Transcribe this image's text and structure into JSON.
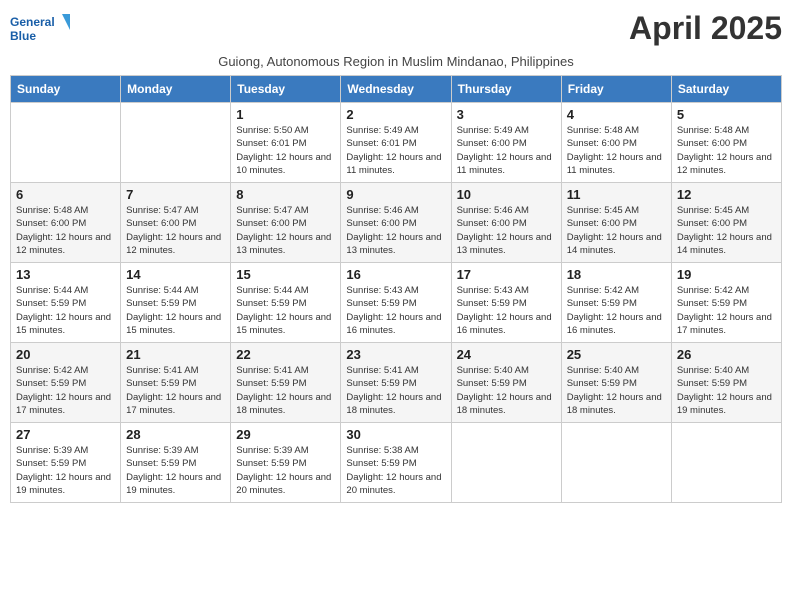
{
  "logo": {
    "general": "General",
    "blue": "Blue"
  },
  "title": "April 2025",
  "subtitle": "Guiong, Autonomous Region in Muslim Mindanao, Philippines",
  "weekdays": [
    "Sunday",
    "Monday",
    "Tuesday",
    "Wednesday",
    "Thursday",
    "Friday",
    "Saturday"
  ],
  "weeks": [
    [
      {
        "day": "",
        "info": ""
      },
      {
        "day": "",
        "info": ""
      },
      {
        "day": "1",
        "info": "Sunrise: 5:50 AM\nSunset: 6:01 PM\nDaylight: 12 hours and 10 minutes."
      },
      {
        "day": "2",
        "info": "Sunrise: 5:49 AM\nSunset: 6:01 PM\nDaylight: 12 hours and 11 minutes."
      },
      {
        "day": "3",
        "info": "Sunrise: 5:49 AM\nSunset: 6:00 PM\nDaylight: 12 hours and 11 minutes."
      },
      {
        "day": "4",
        "info": "Sunrise: 5:48 AM\nSunset: 6:00 PM\nDaylight: 12 hours and 11 minutes."
      },
      {
        "day": "5",
        "info": "Sunrise: 5:48 AM\nSunset: 6:00 PM\nDaylight: 12 hours and 12 minutes."
      }
    ],
    [
      {
        "day": "6",
        "info": "Sunrise: 5:48 AM\nSunset: 6:00 PM\nDaylight: 12 hours and 12 minutes."
      },
      {
        "day": "7",
        "info": "Sunrise: 5:47 AM\nSunset: 6:00 PM\nDaylight: 12 hours and 12 minutes."
      },
      {
        "day": "8",
        "info": "Sunrise: 5:47 AM\nSunset: 6:00 PM\nDaylight: 12 hours and 13 minutes."
      },
      {
        "day": "9",
        "info": "Sunrise: 5:46 AM\nSunset: 6:00 PM\nDaylight: 12 hours and 13 minutes."
      },
      {
        "day": "10",
        "info": "Sunrise: 5:46 AM\nSunset: 6:00 PM\nDaylight: 12 hours and 13 minutes."
      },
      {
        "day": "11",
        "info": "Sunrise: 5:45 AM\nSunset: 6:00 PM\nDaylight: 12 hours and 14 minutes."
      },
      {
        "day": "12",
        "info": "Sunrise: 5:45 AM\nSunset: 6:00 PM\nDaylight: 12 hours and 14 minutes."
      }
    ],
    [
      {
        "day": "13",
        "info": "Sunrise: 5:44 AM\nSunset: 5:59 PM\nDaylight: 12 hours and 15 minutes."
      },
      {
        "day": "14",
        "info": "Sunrise: 5:44 AM\nSunset: 5:59 PM\nDaylight: 12 hours and 15 minutes."
      },
      {
        "day": "15",
        "info": "Sunrise: 5:44 AM\nSunset: 5:59 PM\nDaylight: 12 hours and 15 minutes."
      },
      {
        "day": "16",
        "info": "Sunrise: 5:43 AM\nSunset: 5:59 PM\nDaylight: 12 hours and 16 minutes."
      },
      {
        "day": "17",
        "info": "Sunrise: 5:43 AM\nSunset: 5:59 PM\nDaylight: 12 hours and 16 minutes."
      },
      {
        "day": "18",
        "info": "Sunrise: 5:42 AM\nSunset: 5:59 PM\nDaylight: 12 hours and 16 minutes."
      },
      {
        "day": "19",
        "info": "Sunrise: 5:42 AM\nSunset: 5:59 PM\nDaylight: 12 hours and 17 minutes."
      }
    ],
    [
      {
        "day": "20",
        "info": "Sunrise: 5:42 AM\nSunset: 5:59 PM\nDaylight: 12 hours and 17 minutes."
      },
      {
        "day": "21",
        "info": "Sunrise: 5:41 AM\nSunset: 5:59 PM\nDaylight: 12 hours and 17 minutes."
      },
      {
        "day": "22",
        "info": "Sunrise: 5:41 AM\nSunset: 5:59 PM\nDaylight: 12 hours and 18 minutes."
      },
      {
        "day": "23",
        "info": "Sunrise: 5:41 AM\nSunset: 5:59 PM\nDaylight: 12 hours and 18 minutes."
      },
      {
        "day": "24",
        "info": "Sunrise: 5:40 AM\nSunset: 5:59 PM\nDaylight: 12 hours and 18 minutes."
      },
      {
        "day": "25",
        "info": "Sunrise: 5:40 AM\nSunset: 5:59 PM\nDaylight: 12 hours and 18 minutes."
      },
      {
        "day": "26",
        "info": "Sunrise: 5:40 AM\nSunset: 5:59 PM\nDaylight: 12 hours and 19 minutes."
      }
    ],
    [
      {
        "day": "27",
        "info": "Sunrise: 5:39 AM\nSunset: 5:59 PM\nDaylight: 12 hours and 19 minutes."
      },
      {
        "day": "28",
        "info": "Sunrise: 5:39 AM\nSunset: 5:59 PM\nDaylight: 12 hours and 19 minutes."
      },
      {
        "day": "29",
        "info": "Sunrise: 5:39 AM\nSunset: 5:59 PM\nDaylight: 12 hours and 20 minutes."
      },
      {
        "day": "30",
        "info": "Sunrise: 5:38 AM\nSunset: 5:59 PM\nDaylight: 12 hours and 20 minutes."
      },
      {
        "day": "",
        "info": ""
      },
      {
        "day": "",
        "info": ""
      },
      {
        "day": "",
        "info": ""
      }
    ]
  ]
}
